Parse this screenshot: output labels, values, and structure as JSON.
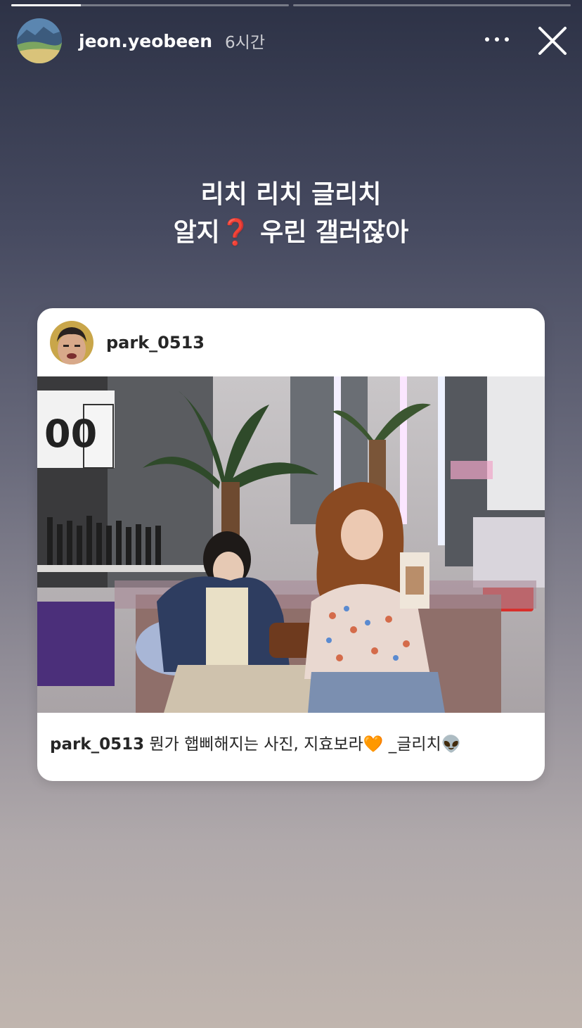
{
  "story": {
    "progress_segments": [
      0.25,
      0
    ]
  },
  "header": {
    "username": "jeon.yeobeen",
    "time": "6시간",
    "more_icon": "more-horizontal-icon",
    "close_icon": "close-icon"
  },
  "overlay_text": {
    "line1": "리치 리치 글리치",
    "line2": "알지❓ 우린 갤러잖아"
  },
  "shared_post": {
    "username": "park_0513",
    "caption_user": "park_0513",
    "caption_text": "뭔가 햅삐해지는 사진, 지효보라🧡 _글리치👽"
  }
}
